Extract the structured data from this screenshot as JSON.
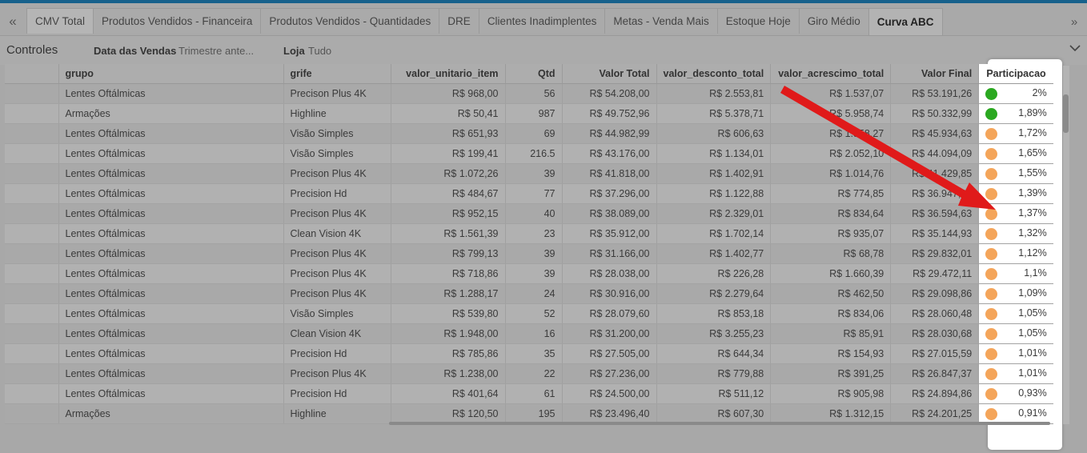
{
  "tabs": {
    "items": [
      {
        "label": "CMV Total",
        "active": false
      },
      {
        "label": "Produtos Vendidos - Financeira",
        "active": false
      },
      {
        "label": "Produtos Vendidos - Quantidades",
        "active": false
      },
      {
        "label": "DRE",
        "active": false
      },
      {
        "label": "Clientes Inadimplentes",
        "active": false
      },
      {
        "label": "Metas - Venda Mais",
        "active": false
      },
      {
        "label": "Estoque Hoje",
        "active": false
      },
      {
        "label": "Giro Médio",
        "active": false
      },
      {
        "label": "Curva ABC",
        "active": true
      }
    ],
    "scroll_left_icon": "double-chevron-left",
    "scroll_right_icon": "double-chevron-right"
  },
  "controls": {
    "title": "Controles",
    "date_label": "Data das Vendas",
    "date_value": "Trimestre ante...",
    "store_label": "Loja",
    "store_value": "Tudo",
    "collapse_icon": "chevron-down"
  },
  "table": {
    "columns": [
      "grupo",
      "grife",
      "valor_unitario_item",
      "Qtd",
      "Valor Total",
      "valor_desconto_total",
      "valor_acrescimo_total",
      "Valor Final",
      "Participacao"
    ],
    "status_colors": {
      "green": "#2aa820",
      "orange": "#f4a55a"
    },
    "rows": [
      {
        "grupo": "Lentes Oftálmicas",
        "grife": "Precison Plus 4K",
        "valor_unitario_item": "R$ 968,00",
        "qtd": "56",
        "valor_total": "R$ 54.208,00",
        "valor_desconto_total": "R$ 2.553,81",
        "valor_acrescimo_total": "R$ 1.537,07",
        "valor_final": "R$ 53.191,26",
        "participacao": "2%",
        "status": "green"
      },
      {
        "grupo": "Armações",
        "grife": "Highline",
        "valor_unitario_item": "R$ 50,41",
        "qtd": "987",
        "valor_total": "R$ 49.752,96",
        "valor_desconto_total": "R$ 5.378,71",
        "valor_acrescimo_total": "R$ 5.958,74",
        "valor_final": "R$ 50.332,99",
        "participacao": "1,89%",
        "status": "green"
      },
      {
        "grupo": "Lentes Oftálmicas",
        "grife": "Visão Simples",
        "valor_unitario_item": "R$ 651,93",
        "qtd": "69",
        "valor_total": "R$ 44.982,99",
        "valor_desconto_total": "R$ 606,63",
        "valor_acrescimo_total": "R$ 1.558,27",
        "valor_final": "R$ 45.934,63",
        "participacao": "1,72%",
        "status": "orange"
      },
      {
        "grupo": "Lentes Oftálmicas",
        "grife": "Visão Simples",
        "valor_unitario_item": "R$ 199,41",
        "qtd": "216.5",
        "valor_total": "R$ 43.176,00",
        "valor_desconto_total": "R$ 1.134,01",
        "valor_acrescimo_total": "R$ 2.052,10",
        "valor_final": "R$ 44.094,09",
        "participacao": "1,65%",
        "status": "orange"
      },
      {
        "grupo": "Lentes Oftálmicas",
        "grife": "Precison Plus 4K",
        "valor_unitario_item": "R$ 1.072,26",
        "qtd": "39",
        "valor_total": "R$ 41.818,00",
        "valor_desconto_total": "R$ 1.402,91",
        "valor_acrescimo_total": "R$ 1.014,76",
        "valor_final": "R$ 41.429,85",
        "participacao": "1,55%",
        "status": "orange"
      },
      {
        "grupo": "Lentes Oftálmicas",
        "grife": "Precision Hd",
        "valor_unitario_item": "R$ 484,67",
        "qtd": "77",
        "valor_total": "R$ 37.296,00",
        "valor_desconto_total": "R$ 1.122,88",
        "valor_acrescimo_total": "R$ 774,85",
        "valor_final": "R$ 36.947,97",
        "participacao": "1,39%",
        "status": "orange"
      },
      {
        "grupo": "Lentes Oftálmicas",
        "grife": "Precison Plus 4K",
        "valor_unitario_item": "R$ 952,15",
        "qtd": "40",
        "valor_total": "R$ 38.089,00",
        "valor_desconto_total": "R$ 2.329,01",
        "valor_acrescimo_total": "R$ 834,64",
        "valor_final": "R$ 36.594,63",
        "participacao": "1,37%",
        "status": "orange"
      },
      {
        "grupo": "Lentes Oftálmicas",
        "grife": "Clean Vision 4K",
        "valor_unitario_item": "R$ 1.561,39",
        "qtd": "23",
        "valor_total": "R$ 35.912,00",
        "valor_desconto_total": "R$ 1.702,14",
        "valor_acrescimo_total": "R$ 935,07",
        "valor_final": "R$ 35.144,93",
        "participacao": "1,32%",
        "status": "orange"
      },
      {
        "grupo": "Lentes Oftálmicas",
        "grife": "Precison Plus 4K",
        "valor_unitario_item": "R$ 799,13",
        "qtd": "39",
        "valor_total": "R$ 31.166,00",
        "valor_desconto_total": "R$ 1.402,77",
        "valor_acrescimo_total": "R$ 68,78",
        "valor_final": "R$ 29.832,01",
        "participacao": "1,12%",
        "status": "orange"
      },
      {
        "grupo": "Lentes Oftálmicas",
        "grife": "Precison Plus 4K",
        "valor_unitario_item": "R$ 718,86",
        "qtd": "39",
        "valor_total": "R$ 28.038,00",
        "valor_desconto_total": "R$ 226,28",
        "valor_acrescimo_total": "R$ 1.660,39",
        "valor_final": "R$ 29.472,11",
        "participacao": "1,1%",
        "status": "orange"
      },
      {
        "grupo": "Lentes Oftálmicas",
        "grife": "Precison Plus 4K",
        "valor_unitario_item": "R$ 1.288,17",
        "qtd": "24",
        "valor_total": "R$ 30.916,00",
        "valor_desconto_total": "R$ 2.279,64",
        "valor_acrescimo_total": "R$ 462,50",
        "valor_final": "R$ 29.098,86",
        "participacao": "1,09%",
        "status": "orange"
      },
      {
        "grupo": "Lentes Oftálmicas",
        "grife": "Visão Simples",
        "valor_unitario_item": "R$ 539,80",
        "qtd": "52",
        "valor_total": "R$ 28.079,60",
        "valor_desconto_total": "R$ 853,18",
        "valor_acrescimo_total": "R$ 834,06",
        "valor_final": "R$ 28.060,48",
        "participacao": "1,05%",
        "status": "orange"
      },
      {
        "grupo": "Lentes Oftálmicas",
        "grife": "Clean Vision 4K",
        "valor_unitario_item": "R$ 1.948,00",
        "qtd": "16",
        "valor_total": "R$ 31.200,00",
        "valor_desconto_total": "R$ 3.255,23",
        "valor_acrescimo_total": "R$ 85,91",
        "valor_final": "R$ 28.030,68",
        "participacao": "1,05%",
        "status": "orange"
      },
      {
        "grupo": "Lentes Oftálmicas",
        "grife": "Precision Hd",
        "valor_unitario_item": "R$ 785,86",
        "qtd": "35",
        "valor_total": "R$ 27.505,00",
        "valor_desconto_total": "R$ 644,34",
        "valor_acrescimo_total": "R$ 154,93",
        "valor_final": "R$ 27.015,59",
        "participacao": "1,01%",
        "status": "orange"
      },
      {
        "grupo": "Lentes Oftálmicas",
        "grife": "Precison Plus 4K",
        "valor_unitario_item": "R$ 1.238,00",
        "qtd": "22",
        "valor_total": "R$ 27.236,00",
        "valor_desconto_total": "R$ 779,88",
        "valor_acrescimo_total": "R$ 391,25",
        "valor_final": "R$ 26.847,37",
        "participacao": "1,01%",
        "status": "orange"
      },
      {
        "grupo": "Lentes Oftálmicas",
        "grife": "Precision Hd",
        "valor_unitario_item": "R$ 401,64",
        "qtd": "61",
        "valor_total": "R$ 24.500,00",
        "valor_desconto_total": "R$ 511,12",
        "valor_acrescimo_total": "R$ 905,98",
        "valor_final": "R$ 24.894,86",
        "participacao": "0,93%",
        "status": "orange"
      },
      {
        "grupo": "Armações",
        "grife": "Highline",
        "valor_unitario_item": "R$ 120,50",
        "qtd": "195",
        "valor_total": "R$ 23.496,40",
        "valor_desconto_total": "R$ 607,30",
        "valor_acrescimo_total": "R$ 1.312,15",
        "valor_final": "R$ 24.201,25",
        "participacao": "0,91%",
        "status": "orange"
      }
    ]
  },
  "annotation": {
    "arrow_color": "#e01a1a"
  }
}
